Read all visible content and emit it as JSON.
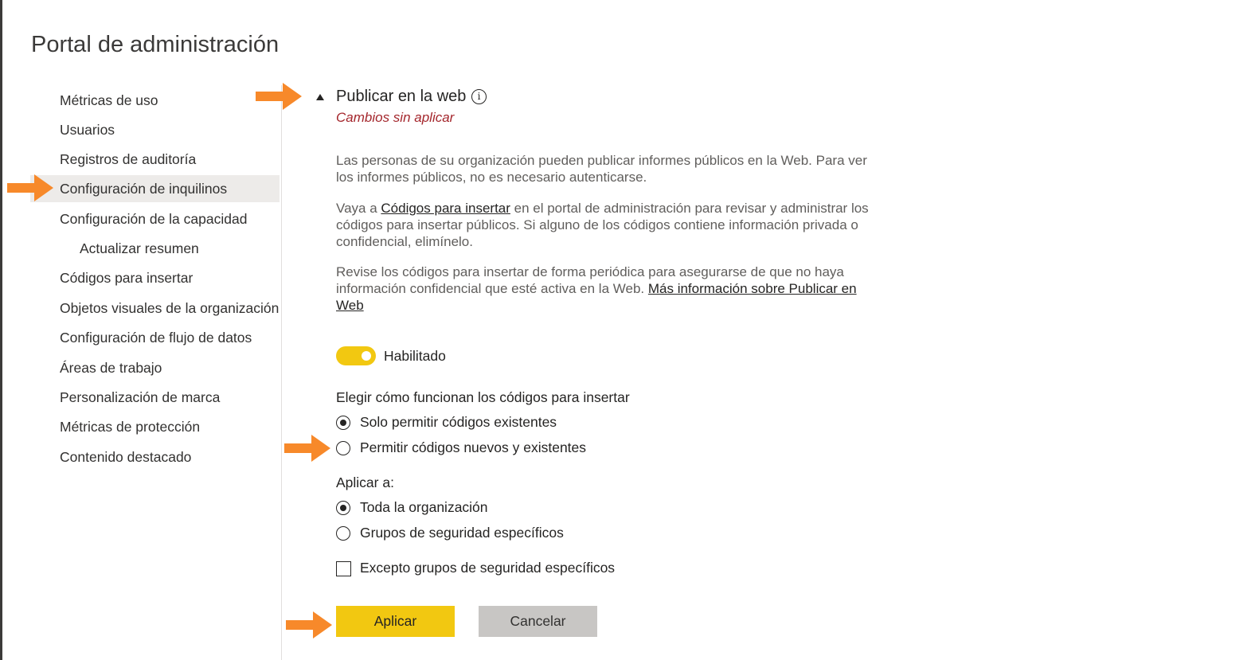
{
  "page": {
    "title": "Portal de administración"
  },
  "sidebar": {
    "items": [
      {
        "label": "Métricas de uso"
      },
      {
        "label": "Usuarios"
      },
      {
        "label": "Registros de auditoría"
      },
      {
        "label": "Configuración de inquilinos",
        "selected": true
      },
      {
        "label": "Configuración de la capacidad"
      },
      {
        "label": "Actualizar resumen"
      },
      {
        "label": "Códigos para insertar"
      },
      {
        "label": "Objetos visuales de la organización"
      },
      {
        "label": "Configuración de flujo de datos"
      },
      {
        "label": "Áreas de trabajo"
      },
      {
        "label": "Personalización de marca"
      },
      {
        "label": "Métricas de protección"
      },
      {
        "label": "Contenido destacado"
      }
    ]
  },
  "section": {
    "title": "Publicar en la web",
    "info_icon": "i",
    "status": "Cambios sin aplicar",
    "para1": "Las personas de su organización pueden publicar informes públicos en la Web. Para ver los informes públicos, no es necesario autenticarse.",
    "para2_pre": "Vaya a ",
    "para2_link": "Códigos para insertar",
    "para2_post": " en el portal de administración para revisar y administrar los códigos para insertar públicos. Si alguno de los códigos contiene información privada o confidencial, elimínelo.",
    "para3_pre": "Revise los códigos para insertar de forma periódica para asegurarse de que no haya información confidencial que esté activa en la Web. ",
    "para3_link": "Más información sobre Publicar en Web",
    "toggle": {
      "label": "Habilitado",
      "enabled": true
    },
    "embed_group": {
      "label": "Elegir cómo funcionan los códigos para insertar",
      "options": [
        {
          "label": "Solo permitir códigos existentes",
          "checked": true
        },
        {
          "label": "Permitir códigos nuevos y existentes",
          "checked": false
        }
      ]
    },
    "apply_group": {
      "label": "Aplicar a:",
      "options": [
        {
          "label": "Toda la organización",
          "checked": true
        },
        {
          "label": "Grupos de seguridad específicos",
          "checked": false
        }
      ]
    },
    "except_checkbox": {
      "label": "Excepto grupos de seguridad específicos",
      "checked": false
    },
    "apply_button": "Aplicar",
    "cancel_button": "Cancelar"
  },
  "colors": {
    "accent_yellow": "#f2c811",
    "arrow_orange": "#f7892a",
    "unsaved_red": "#a4262c",
    "selected_bg": "#edebe9"
  }
}
